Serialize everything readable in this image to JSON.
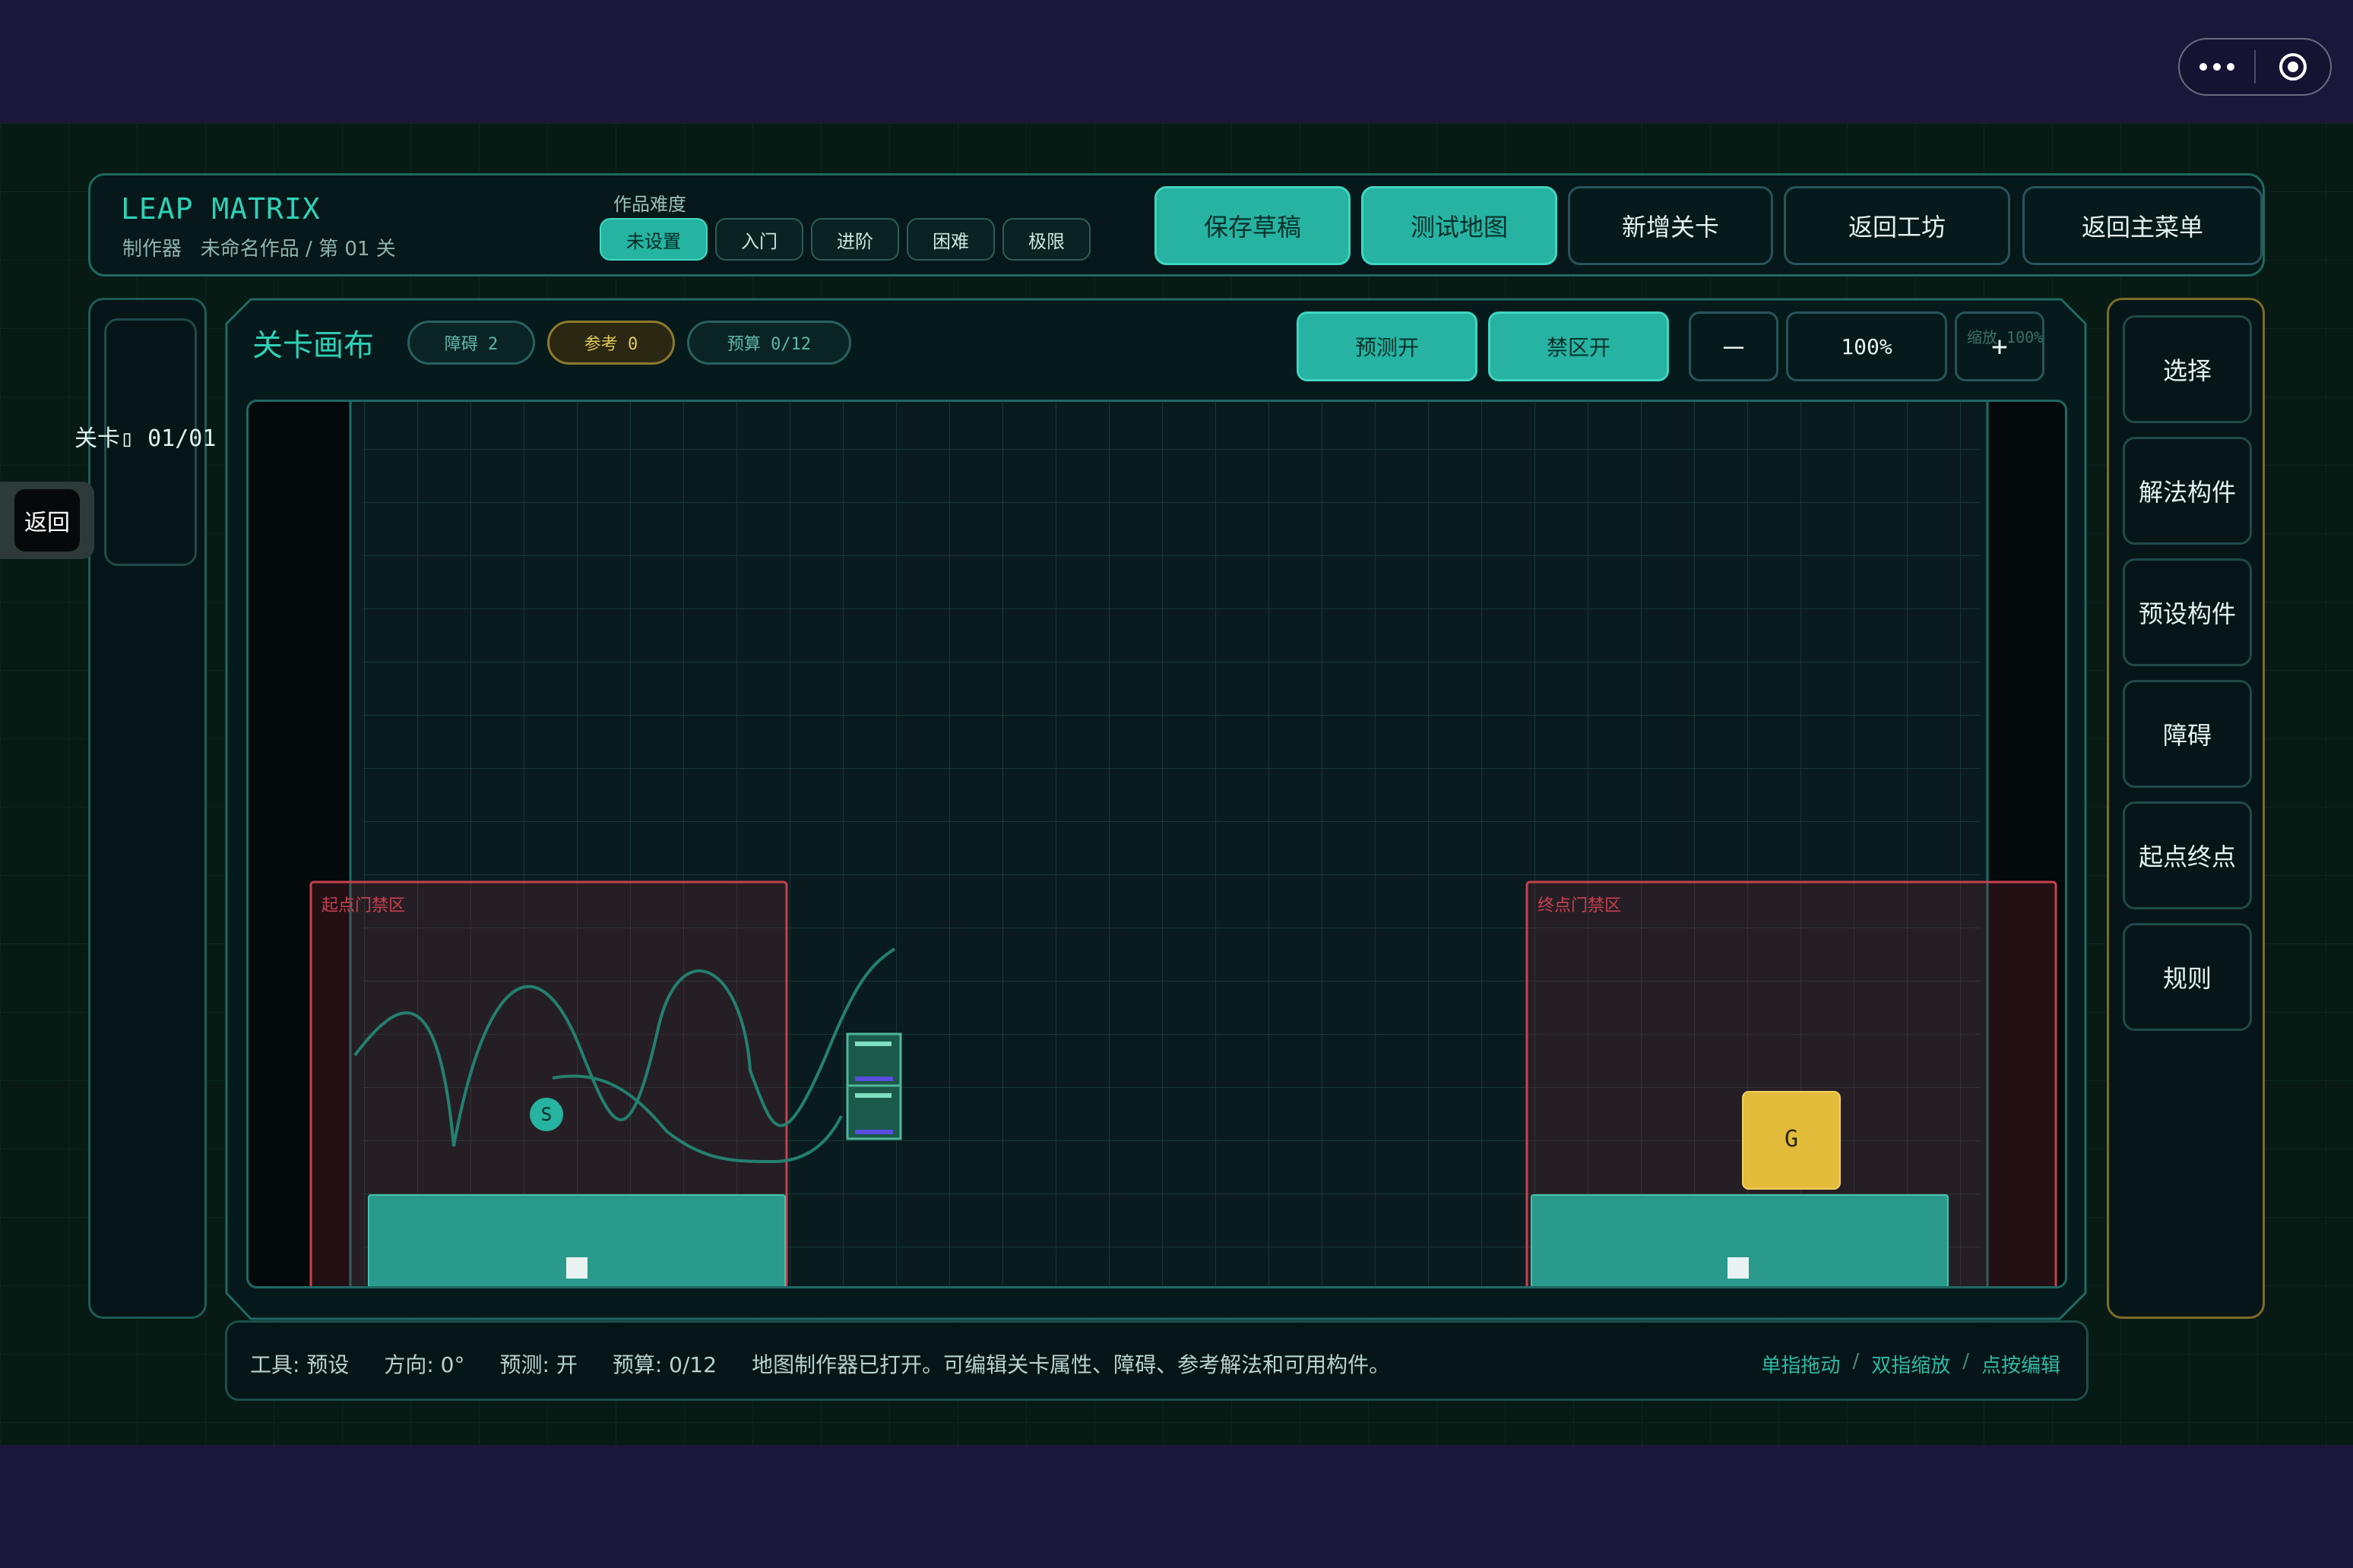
{
  "capsule": {
    "more_icon": "more-dots-icon",
    "close_icon": "target-circle-icon"
  },
  "header": {
    "title": "LEAP MATRIX",
    "subtitle": "制作器   未命名作品 / 第 01 关",
    "difficulty_label": "作品难度",
    "difficulty_options": [
      "未设置",
      "入门",
      "进阶",
      "困难",
      "极限"
    ],
    "difficulty_selected": "未设置",
    "buttons": {
      "save_draft": "保存草稿",
      "test_map": "测试地图",
      "add_level": "新增关卡",
      "back_workshop": "返回工坊",
      "back_menu": "返回主菜单"
    }
  },
  "left": {
    "level_label": "关卡▯ 01/01",
    "back": "返回"
  },
  "canvas": {
    "title": "关卡画布",
    "tags": {
      "obstacle": "障碍 2",
      "reference": "参考 0",
      "budget": "预算 0/12"
    },
    "buttons": {
      "predict": "预测开",
      "forbidden": "禁区开",
      "zoom_out": "－",
      "zoom_level": "100%",
      "zoom_in": "+"
    },
    "zoom_hint": "缩放 100%",
    "start_zone_label": "起点门禁区",
    "end_zone_label": "终点门禁区",
    "start_marker": "S",
    "goal_marker": "G"
  },
  "tools": [
    "选择",
    "解法构件",
    "预设构件",
    "障碍",
    "起点终点",
    "规则"
  ],
  "status": {
    "tool": "工具: 预设",
    "direction": "方向: 0°",
    "predict": "预测: 开",
    "budget": "预算: 0/12",
    "message": "地图制作器已打开。可编辑关卡属性、障碍、参考解法和可用构件。",
    "hints": [
      "单指拖动",
      "双指缩放",
      "点按编辑"
    ]
  },
  "colors": {
    "accent": "#26b3a1",
    "forbidden_zone": "#c8404e",
    "goal": "#e2bc3a",
    "background": "#071a14"
  }
}
